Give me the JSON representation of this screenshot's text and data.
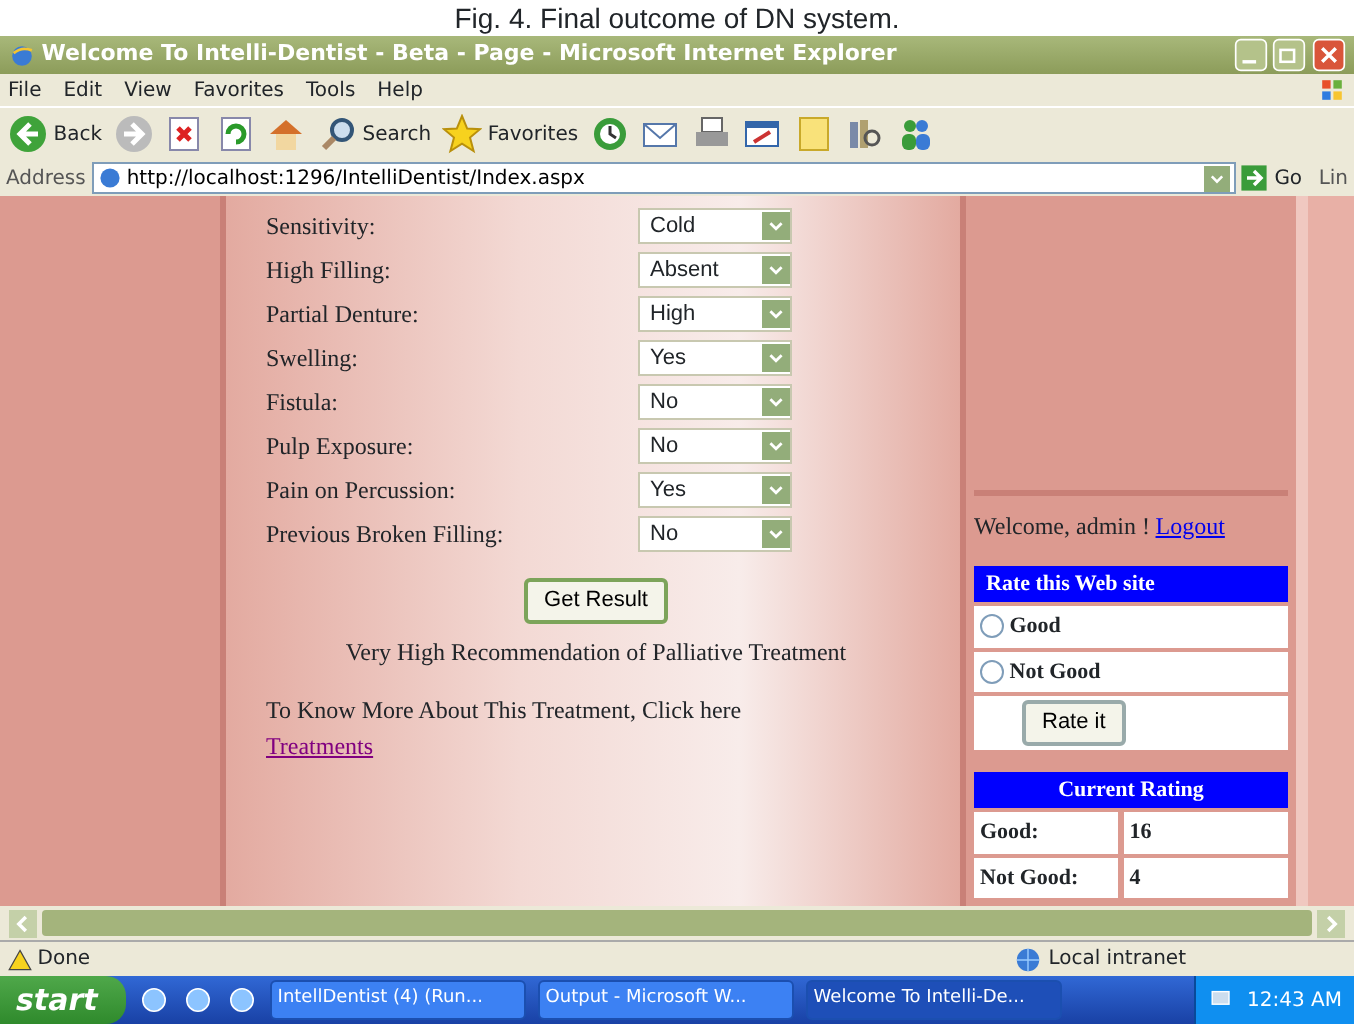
{
  "caption": "Fig. 4. Final outcome of DN system.",
  "window": {
    "title": "Welcome To Intelli-Dentist - Beta - Page - Microsoft Internet Explorer"
  },
  "menu": [
    "File",
    "Edit",
    "View",
    "Favorites",
    "Tools",
    "Help"
  ],
  "toolbar": [
    {
      "kind": "back",
      "label": "Back"
    },
    {
      "kind": "forward"
    },
    {
      "kind": "stop"
    },
    {
      "kind": "refresh"
    },
    {
      "kind": "home"
    },
    {
      "kind": "search",
      "label": "Search"
    },
    {
      "kind": "favorites",
      "label": "Favorites"
    },
    {
      "kind": "history"
    },
    {
      "kind": "mail"
    },
    {
      "kind": "print"
    },
    {
      "kind": "edit"
    },
    {
      "kind": "note"
    },
    {
      "kind": "research"
    },
    {
      "kind": "messenger"
    }
  ],
  "address": {
    "label": "Address",
    "value": "http://localhost:1296/IntelliDentist/Index.aspx",
    "go": "Go",
    "links": "Lin"
  },
  "form": [
    {
      "label": "Sensitivity:",
      "value": "Cold"
    },
    {
      "label": "High Filling:",
      "value": "Absent"
    },
    {
      "label": "Partial Denture:",
      "value": "High"
    },
    {
      "label": "Swelling:",
      "value": "Yes"
    },
    {
      "label": "Fistula:",
      "value": "No"
    },
    {
      "label": "Pulp Exposure:",
      "value": "No"
    },
    {
      "label": "Pain on Percussion:",
      "value": "Yes"
    },
    {
      "label": "Previous Broken Filling:",
      "value": "No"
    }
  ],
  "submit": "Get Result",
  "result": "Very High Recommendation of Palliative Treatment",
  "more": {
    "text": "To Know More About This Treatment, Click here",
    "link": "Treatments"
  },
  "welcome": {
    "text": "Welcome, admin !",
    "link": "Logout"
  },
  "rate": {
    "title": "Rate this Web site",
    "options": [
      {
        "label": "Good",
        "selected": false
      },
      {
        "label": "Not Good",
        "selected": false
      }
    ],
    "button": "Rate it"
  },
  "rating": {
    "title": "Current Rating",
    "rows": [
      {
        "label": "Good:",
        "value": "16"
      },
      {
        "label": "Not Good:",
        "value": "4"
      }
    ]
  },
  "status_bar": {
    "text": "Done",
    "zone": "Local intranet"
  },
  "taskbar": {
    "start": "start",
    "tasks": [
      {
        "label": "IntellDentist (4) (Run...",
        "selected": false
      },
      {
        "label": "Output - Microsoft W...",
        "selected": false
      },
      {
        "label": "Welcome To Intelli-De...",
        "selected": true
      }
    ],
    "clock": "12:43 AM"
  }
}
